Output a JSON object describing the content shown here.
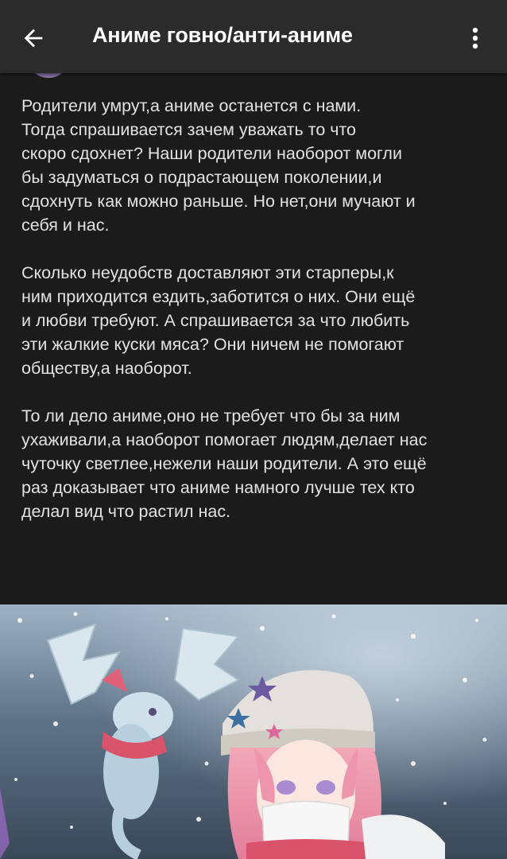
{
  "header": {
    "title": "Аниме говно/анти-аниме"
  },
  "post": {
    "paragraphs": [
      {
        "lines": [
          "Родители умрут,а аниме останется с нами.",
          "Тогда спрашивается зачем уважать то что",
          "скоро сдохнет? Наши родители наоборот могли",
          "бы задуматься о подрастающем поколении,и",
          "сдохнуть как можно раньше. Но нет,они мучают и",
          "себя и нас."
        ]
      },
      {
        "lines": [
          "Сколько неудобств доставляют эти старперы,к",
          "ним приходится ездить,заботится о них. Они ещё",
          "и любви требуют. А спрашивается за что любить",
          "эти жалкие куски мяса? Они ничем не помогают",
          "обществу,а наоборот."
        ]
      },
      {
        "lines": [
          "То ли дело аниме,оно не требует что бы за ним",
          "ухаживали,а наоборот помогает людям,делает нас",
          "чуточку светлее,нежели наши родители. А это ещё",
          "раз доказывает что аниме намного лучше тех кто",
          "делал вид что растил нас."
        ]
      }
    ],
    "image": {
      "alt": "anime illustration"
    }
  },
  "colors": {
    "background": "#1b1b1b",
    "topbar": "#2b2b2b",
    "text": "#e2e2e2",
    "title": "#ffffff"
  },
  "icons": {
    "back": "arrow-left-icon",
    "more": "more-vertical-icon"
  }
}
